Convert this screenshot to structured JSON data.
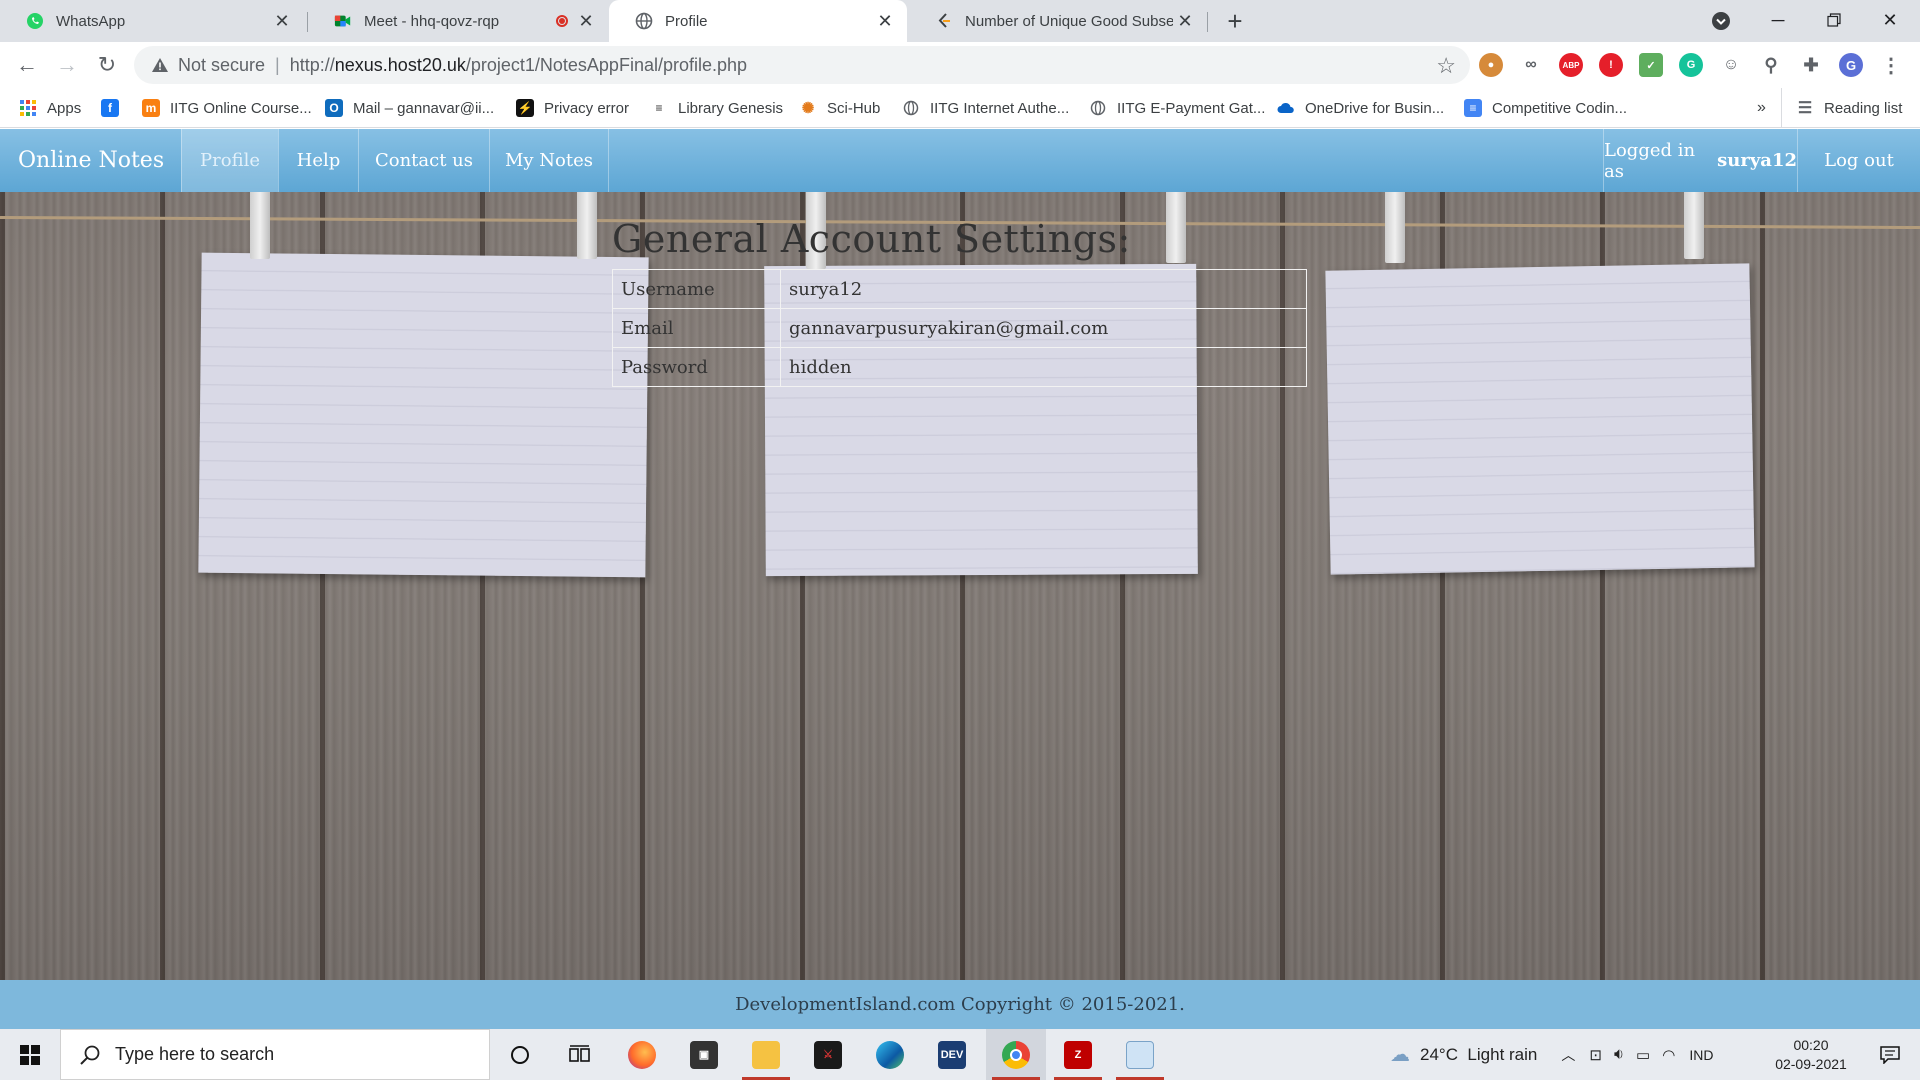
{
  "browser": {
    "tabs": [
      {
        "title": "WhatsApp",
        "icon": "whatsapp-icon"
      },
      {
        "title": "Meet - hhq-qovz-rqp",
        "icon": "google-meet-icon"
      },
      {
        "title": "Profile",
        "icon": "globe-icon"
      },
      {
        "title": "Number of Unique Good Subseq",
        "icon": "leetcode-icon"
      }
    ],
    "security_label": "Not secure",
    "url_prefix": "http://",
    "url_host": "nexus.host20.uk",
    "url_path": "/project1/NotesAppFinal/profile.php",
    "profile_initial": "G",
    "bookmarks": [
      {
        "label": "Apps",
        "icon": "apps-grid-icon"
      },
      {
        "label": "",
        "icon": "facebook-icon"
      },
      {
        "label": "IITG Online Course...",
        "icon": "moodle-icon"
      },
      {
        "label": "Mail – gannavar@ii...",
        "icon": "outlook-icon"
      },
      {
        "label": "Privacy error",
        "icon": "bookmark-page-icon"
      },
      {
        "label": "Library Genesis",
        "icon": "library-icon"
      },
      {
        "label": "Sci-Hub",
        "icon": "scihub-icon"
      },
      {
        "label": "IITG Internet Authe...",
        "icon": "globe-icon"
      },
      {
        "label": "IITG E-Payment Gat...",
        "icon": "globe-icon"
      },
      {
        "label": "OneDrive for Busin...",
        "icon": "onedrive-icon"
      },
      {
        "label": "Competitive Codin...",
        "icon": "doc-icon"
      }
    ],
    "more_bookmarks": "»",
    "reading_list": "Reading list"
  },
  "site": {
    "brand": "Online Notes",
    "nav": [
      {
        "label": "Profile",
        "active": true
      },
      {
        "label": "Help",
        "active": false
      },
      {
        "label": "Contact us",
        "active": false
      },
      {
        "label": "My Notes",
        "active": false
      }
    ],
    "logged_in_prefix": "Logged in as",
    "username_display": "surya12",
    "logout": "Log out",
    "settings_title": "General Account Settings:",
    "settings": [
      {
        "key": "Username",
        "value": "surya12"
      },
      {
        "key": "Email",
        "value": "gannavarpusuryakiran@gmail.com"
      },
      {
        "key": "Password",
        "value": "hidden"
      }
    ],
    "footer": "DevelopmentIsland.com Copyright © 2015-2021."
  },
  "taskbar": {
    "search_placeholder": "Type here to search",
    "weather": "24°C  Light rain",
    "language": "IND",
    "time": "00:20",
    "date": "02-09-2021"
  },
  "colors": {
    "navbar": "#6aaedb",
    "footer": "#7eb8dc",
    "tab_bar": "#dee1e6"
  }
}
